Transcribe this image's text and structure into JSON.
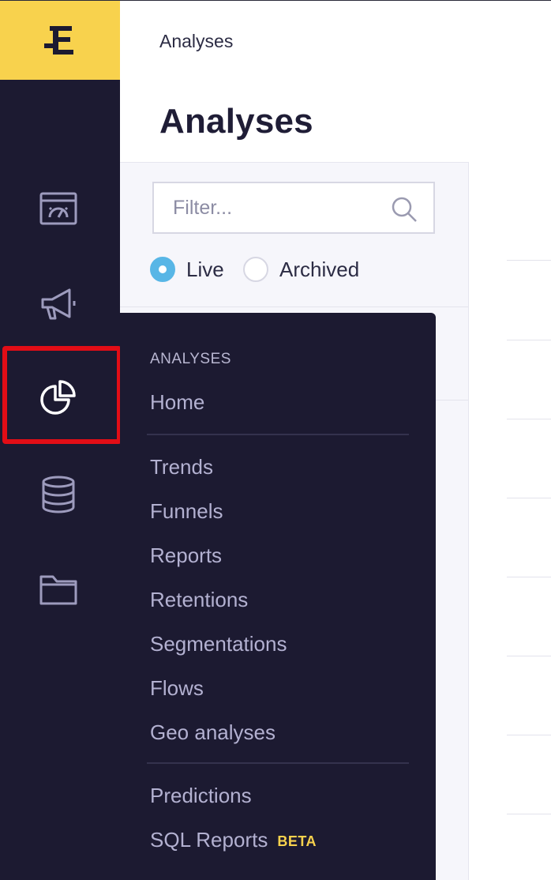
{
  "header": {
    "breadcrumb": "Analyses",
    "title": "Analyses"
  },
  "filter": {
    "placeholder": "Filter...",
    "value": ""
  },
  "status_options": [
    {
      "label": "Live",
      "checked": true
    },
    {
      "label": "Archived",
      "checked": false
    }
  ],
  "sidebar": {
    "icons": [
      "dashboard-icon",
      "megaphone-icon",
      "pie-chart-icon",
      "database-icon",
      "folder-icon"
    ],
    "active": "pie-chart-icon"
  },
  "menu": {
    "heading": "ANALYSES",
    "home": "Home",
    "group1": [
      "Trends",
      "Funnels",
      "Reports",
      "Retentions",
      "Segmentations",
      "Flows",
      "Geo analyses"
    ],
    "predictions": "Predictions",
    "sql_reports": "SQL Reports",
    "beta_badge": "BETA"
  },
  "colors": {
    "rail": "#1c1a31",
    "logo_bg": "#f8d24d",
    "highlight": "#e20d16",
    "radio_checked": "#58b6e6"
  }
}
